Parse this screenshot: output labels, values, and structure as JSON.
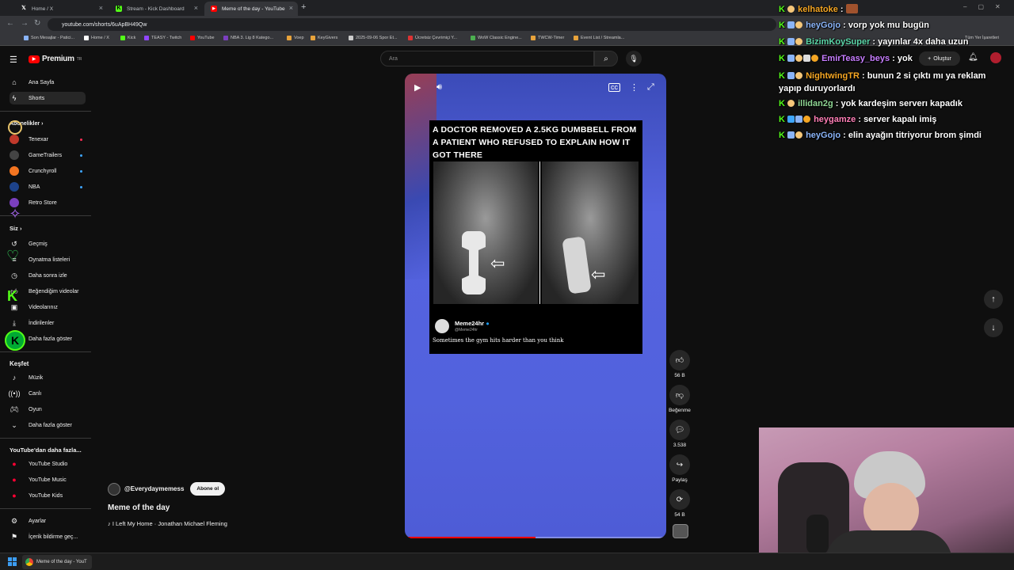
{
  "browser": {
    "tabs": [
      {
        "label": "Home / X",
        "icon": "x-icon"
      },
      {
        "label": "Stream - Kick Dashboard",
        "icon": "kick-icon"
      },
      {
        "label": "Meme of the day - YouTube",
        "icon": "youtube-icon"
      }
    ],
    "url": "youtube.com/shorts/6uApBH49Qw",
    "bookmarks": [
      "Son Mesajlar - Patici...",
      "Home / X",
      "Kick",
      "TEASY - Twitch",
      "YouTube",
      "NBA 3. Lig 8 Katego...",
      "Voep",
      "KeyGivers",
      "2025-09-06 Spor Et...",
      "Ücretsiz Çevrimiçi Y...",
      "WoW Classic Engine...",
      "TWCW-Timer",
      "Event List / Streamla..."
    ],
    "bookmarks_right": "Tüm Yer İşaretleri"
  },
  "youtube": {
    "logo": "Premium",
    "logo_sup": "TR",
    "search_placeholder": "Ara",
    "create_label": "Oluştur",
    "sidebar": {
      "main": [
        {
          "label": "Ana Sayfa",
          "icon": "home-icon"
        },
        {
          "label": "Shorts",
          "icon": "shorts-icon"
        }
      ],
      "subscriptions_title": "Abonelikler",
      "subscriptions": [
        {
          "label": "Tenexar",
          "color": "#c0392b"
        },
        {
          "label": "GameTrailers",
          "color": "#444444"
        },
        {
          "label": "Crunchyroll",
          "color": "#f47521"
        },
        {
          "label": "NBA",
          "color": "#1d428a"
        },
        {
          "label": "Retro Store",
          "color": "#7b3fbf"
        }
      ],
      "you_title": "Siz",
      "you": [
        {
          "label": "Geçmiş",
          "icon": "history-icon"
        },
        {
          "label": "Oynatma listeleri",
          "icon": "playlist-icon"
        },
        {
          "label": "Daha sonra izle",
          "icon": "clock-icon"
        },
        {
          "label": "Beğendiğim videolar",
          "icon": "like-icon"
        },
        {
          "label": "Videolarınız",
          "icon": "video-icon"
        },
        {
          "label": "İndirilenler",
          "icon": "download-icon"
        },
        {
          "label": "Daha fazla göster",
          "icon": "chevron-down-icon"
        }
      ],
      "explore_title": "Keşfet",
      "explore": [
        {
          "label": "Müzik",
          "icon": "music-icon"
        },
        {
          "label": "Canlı",
          "icon": "live-icon"
        },
        {
          "label": "Oyun",
          "icon": "game-icon"
        },
        {
          "label": "Daha fazla göster",
          "icon": "chevron-down-icon"
        }
      ],
      "more_title": "YouTube'dan daha fazla...",
      "more": [
        {
          "label": "YouTube Studio"
        },
        {
          "label": "YouTube Music"
        },
        {
          "label": "YouTube Kids"
        }
      ],
      "bottom": [
        {
          "label": "Ayarlar",
          "icon": "gear-icon"
        },
        {
          "label": "İçerik bildirme geç...",
          "icon": "flag-icon"
        }
      ]
    },
    "short": {
      "meme_caption": "A DOCTOR REMOVED A 2.5KG DUMBBELL FROM A PATIENT WHO REFUSED TO EXPLAIN HOW IT GOT THERE",
      "meme_account": "Meme24hr",
      "meme_handle": "@Meme24hr",
      "meme_text": "Sometimes the gym hits harder than you think",
      "channel": "@Everydaymemess",
      "subscribe_label": "Abone ol",
      "title": "Meme of the day",
      "music": "♪ I Left My Home · Jonathan Michael Fleming",
      "progress": 0.5
    },
    "actions": {
      "likes": "56 B",
      "dislike_label": "Beğenme",
      "comments": "3.538",
      "share_label": "Paylaş",
      "remix": "54 B"
    }
  },
  "chat": [
    {
      "user": "kelhatoke",
      "color": "#f5a623",
      "msg": ""
    },
    {
      "user": "heyGojo",
      "color": "#8ab4f8",
      "msg": "vorp yok mu bugün"
    },
    {
      "user": "BizimKoySuper",
      "color": "#5bd6a8",
      "msg": "yayınlar 4x daha uzun"
    },
    {
      "user": "EmirTeasy_beys",
      "color": "#c77dff",
      "msg": "yok"
    },
    {
      "user": "NightwingTR",
      "color": "#f5a623",
      "msg": "bunun 2 si çıktı mı ya reklam yapıp duruyorlardı"
    },
    {
      "user": "illidan2g",
      "color": "#8fd694",
      "msg": "yok kardeşim serverı kapadık"
    },
    {
      "user": "heygamze",
      "color": "#ff7eb6",
      "msg": "server kapalı imiş"
    },
    {
      "user": "heyGojo",
      "color": "#8ab4f8",
      "msg": "elin ayağın titriyorur brom şimdi"
    }
  ],
  "taskbar": {
    "active_window": "Meme of the day - YouT"
  }
}
